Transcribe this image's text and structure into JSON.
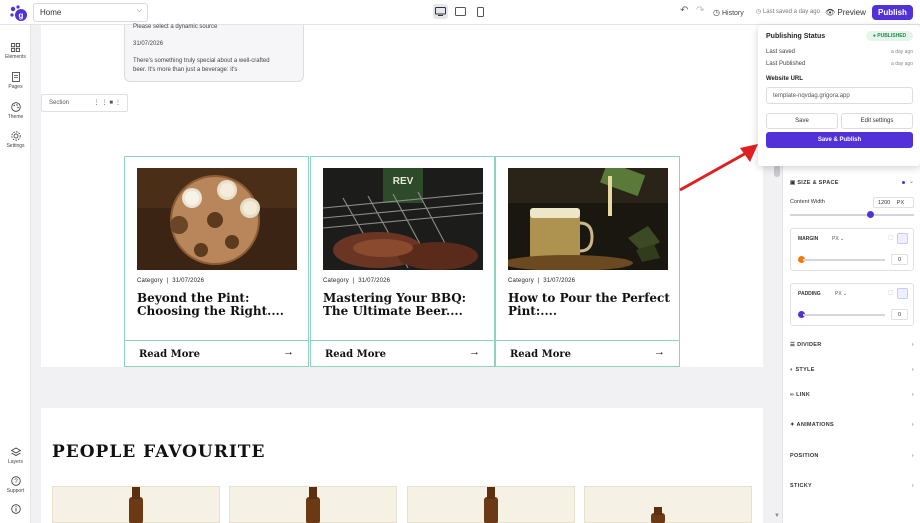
{
  "topbar": {
    "page_select": "Home",
    "history_label": "History",
    "last_saved": "Last saved a day ago",
    "preview_label": "Preview",
    "publish_label": "Publish"
  },
  "leftrail": {
    "items": [
      {
        "label": "Elements",
        "icon": "grid-icon"
      },
      {
        "label": "Pages",
        "icon": "page-icon"
      },
      {
        "label": "Theme",
        "icon": "palette-icon"
      },
      {
        "label": "Settings",
        "icon": "gear-icon"
      }
    ],
    "bottom": [
      {
        "label": "Layers",
        "icon": "layers-icon"
      },
      {
        "label": "Support",
        "icon": "help-icon"
      }
    ]
  },
  "canvas": {
    "prev_card_lines": [
      "Please select a dynamic source",
      "31/07/2026",
      "There's something truly special about a well-crafted",
      "beer. It's more than just a beverage: it's"
    ],
    "section_tag": "Section",
    "cards": [
      {
        "category": "Category",
        "sep": "|",
        "date": "31/07/2026",
        "title": "Beyond the Pint: Choosing the Right....",
        "read_more": "Read More"
      },
      {
        "category": "Category",
        "sep": "|",
        "date": "31/07/2026",
        "title": "Mastering Your BBQ: The Ultimate Beer....",
        "read_more": "Read More"
      },
      {
        "category": "Category",
        "sep": "|",
        "date": "31/07/2026",
        "title": "How to Pour the Perfect Pint:....",
        "read_more": "Read More"
      }
    ],
    "people_heading": "PEOPLE FAVOURITE"
  },
  "popover": {
    "title": "Publishing Status",
    "badge": "PUBLISHED",
    "last_saved_label": "Last saved",
    "last_saved_value": "a day ago",
    "last_published_label": "Last Published",
    "last_published_value": "a day ago",
    "website_url_label": "Website URL",
    "website_url": "template-nqvdag.grigora.app",
    "save_label": "Save",
    "edit_settings_label": "Edit settings",
    "save_publish_label": "Save & Publish"
  },
  "rightpanel": {
    "size_space_label": "SIZE & SPACE",
    "content_width_label": "Content Width",
    "content_width_value": "1200",
    "content_width_unit": "PX",
    "content_width_fraction": 0.65,
    "margin_label": "MARGIN",
    "margin_unit": "PX",
    "margin_value": "0",
    "padding_label": "PADDING",
    "padding_unit": "PX",
    "padding_value": "0",
    "groups": [
      "DIVIDER",
      "STYLE",
      "LINK",
      "ANIMATIONS",
      "POSITION",
      "STICKY"
    ]
  },
  "colors": {
    "accent": "#5232d8",
    "card_border": "#8fd3bb",
    "published": "#1f8a4c",
    "annotation_arrow": "#e02020"
  }
}
